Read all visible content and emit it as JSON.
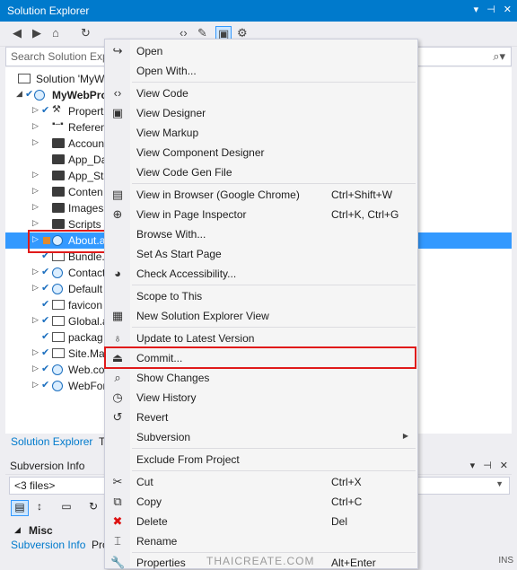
{
  "window": {
    "title": "Solution Explorer",
    "buttons": [
      "▾",
      "⊣",
      "✕"
    ]
  },
  "search": {
    "placeholder": "Search Solution Explo"
  },
  "tree": {
    "rows": [
      {
        "label": "Solution 'MyW"
      },
      {
        "label": "MyWebPro"
      },
      {
        "label": "Propert"
      },
      {
        "label": "Referen"
      },
      {
        "label": "Accoun"
      },
      {
        "label": "App_Da"
      },
      {
        "label": "App_Sta"
      },
      {
        "label": "Conten"
      },
      {
        "label": "Images"
      },
      {
        "label": "Scripts"
      },
      {
        "label": "About.a"
      },
      {
        "label": "Bundle."
      },
      {
        "label": "Contact"
      },
      {
        "label": "Default"
      },
      {
        "label": "favicon"
      },
      {
        "label": "Global.a"
      },
      {
        "label": "packag"
      },
      {
        "label": "Site.Ma"
      },
      {
        "label": "Web.co"
      },
      {
        "label": "WebFor"
      }
    ]
  },
  "tabs": {
    "solution_explorer": "Solution Explorer",
    "other": "T"
  },
  "subversion": {
    "title": "Subversion Info",
    "files": "<3 files>",
    "misc": "Misc",
    "tab_label": "Subversion Info",
    "tab_other": "Pro"
  },
  "status": {
    "ins": "INS"
  },
  "watermark": "THAICREATE.COM",
  "context_menu": {
    "items": [
      {
        "label": "Open",
        "shortcut": "",
        "icon": "open-icon"
      },
      {
        "label": "Open With...",
        "shortcut": "",
        "icon": ""
      },
      {
        "label": "View Code",
        "shortcut": "",
        "icon": "code-icon"
      },
      {
        "label": "View Designer",
        "shortcut": "",
        "icon": "designer-icon"
      },
      {
        "label": "View Markup",
        "shortcut": "",
        "icon": ""
      },
      {
        "label": "View Component Designer",
        "shortcut": "",
        "icon": ""
      },
      {
        "label": "View Code Gen File",
        "shortcut": "",
        "icon": ""
      },
      {
        "label": "View in Browser (Google Chrome)",
        "shortcut": "Ctrl+Shift+W",
        "icon": "browser-icon"
      },
      {
        "label": "View in Page Inspector",
        "shortcut": "Ctrl+K, Ctrl+G",
        "icon": "inspector-icon"
      },
      {
        "label": "Browse With...",
        "shortcut": "",
        "icon": ""
      },
      {
        "label": "Set As Start Page",
        "shortcut": "",
        "icon": ""
      },
      {
        "label": "Check Accessibility...",
        "shortcut": "",
        "icon": "accessibility-icon"
      },
      {
        "label": "Scope to This",
        "shortcut": "",
        "icon": ""
      },
      {
        "label": "New Solution Explorer View",
        "shortcut": "",
        "icon": "new-view-icon"
      },
      {
        "label": "Update to Latest Version",
        "shortcut": "",
        "icon": "update-icon"
      },
      {
        "label": "Commit...",
        "shortcut": "",
        "icon": "commit-icon"
      },
      {
        "label": "Show Changes",
        "shortcut": "",
        "icon": "changes-icon"
      },
      {
        "label": "View History",
        "shortcut": "",
        "icon": "history-icon"
      },
      {
        "label": "Revert",
        "shortcut": "",
        "icon": "revert-icon"
      },
      {
        "label": "Subversion",
        "shortcut": "",
        "icon": ""
      },
      {
        "label": "Exclude From Project",
        "shortcut": "",
        "icon": ""
      },
      {
        "label": "Cut",
        "shortcut": "Ctrl+X",
        "icon": "cut-icon"
      },
      {
        "label": "Copy",
        "shortcut": "Ctrl+C",
        "icon": "copy-icon"
      },
      {
        "label": "Delete",
        "shortcut": "Del",
        "icon": "delete-icon"
      },
      {
        "label": "Rename",
        "shortcut": "",
        "icon": "rename-icon"
      },
      {
        "label": "Properties",
        "shortcut": "Alt+Enter",
        "icon": "properties-icon"
      }
    ]
  },
  "colors": {
    "accent": "#007acc",
    "selection": "#3399ff",
    "highlight_box": "#e01a1a"
  }
}
